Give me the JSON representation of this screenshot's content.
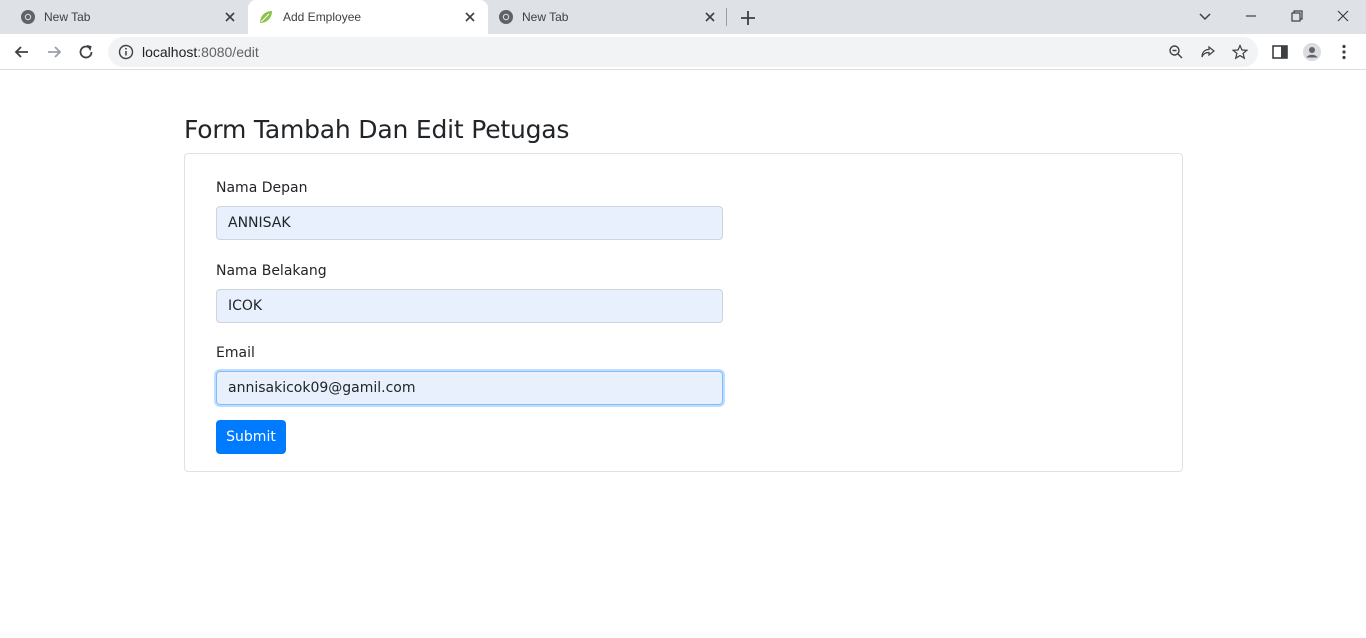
{
  "browser": {
    "tabs": [
      {
        "title": "New Tab",
        "icon": "chrome-icon",
        "active": false
      },
      {
        "title": "Add Employee",
        "icon": "spring-leaf-icon",
        "active": true
      },
      {
        "title": "New Tab",
        "icon": "chrome-icon",
        "active": false
      }
    ],
    "url_host": "localhost",
    "url_rest": ":8080/edit"
  },
  "page": {
    "title": "Form Tambah Dan Edit Petugas",
    "form": {
      "first_name_label": "Nama Depan",
      "first_name_value": "ANNISAK",
      "last_name_label": "Nama Belakang",
      "last_name_value": "ICOK",
      "email_label": "Email",
      "email_value": "annisakicok09@gamil.com",
      "submit_label": "Submit"
    }
  },
  "colors": {
    "primary": "#007bff",
    "input_autofill_bg": "#e8f0fe",
    "tabstrip_bg": "#dee1e6"
  }
}
